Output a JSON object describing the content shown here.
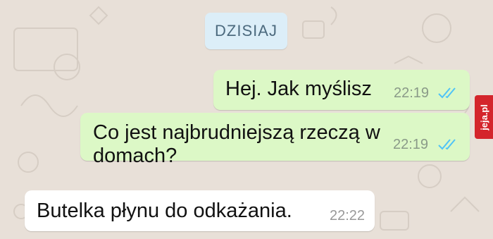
{
  "chat": {
    "date_label": "DZISIAJ",
    "messages": [
      {
        "direction": "outgoing",
        "text": "Hej. Jak myślisz",
        "time": "22:19",
        "status": "read"
      },
      {
        "direction": "outgoing",
        "text_line1": "Co jest najbrudniejszą rzeczą w",
        "text_line2": "domach?",
        "time": "22:19",
        "status": "read"
      },
      {
        "direction": "incoming",
        "text": "Butelka płynu do odkażania.",
        "time": "22:22"
      }
    ]
  },
  "watermark": {
    "text": "jeja.pl"
  },
  "colors": {
    "wallpaper": "#e8e0d8",
    "outgoing_bubble": "#dcf8c6",
    "incoming_bubble": "#ffffff",
    "date_chip": "#dceef8",
    "read_ticks": "#4fc3f7",
    "brand": "#d4252c"
  },
  "icons": [
    "double-check-icon"
  ]
}
